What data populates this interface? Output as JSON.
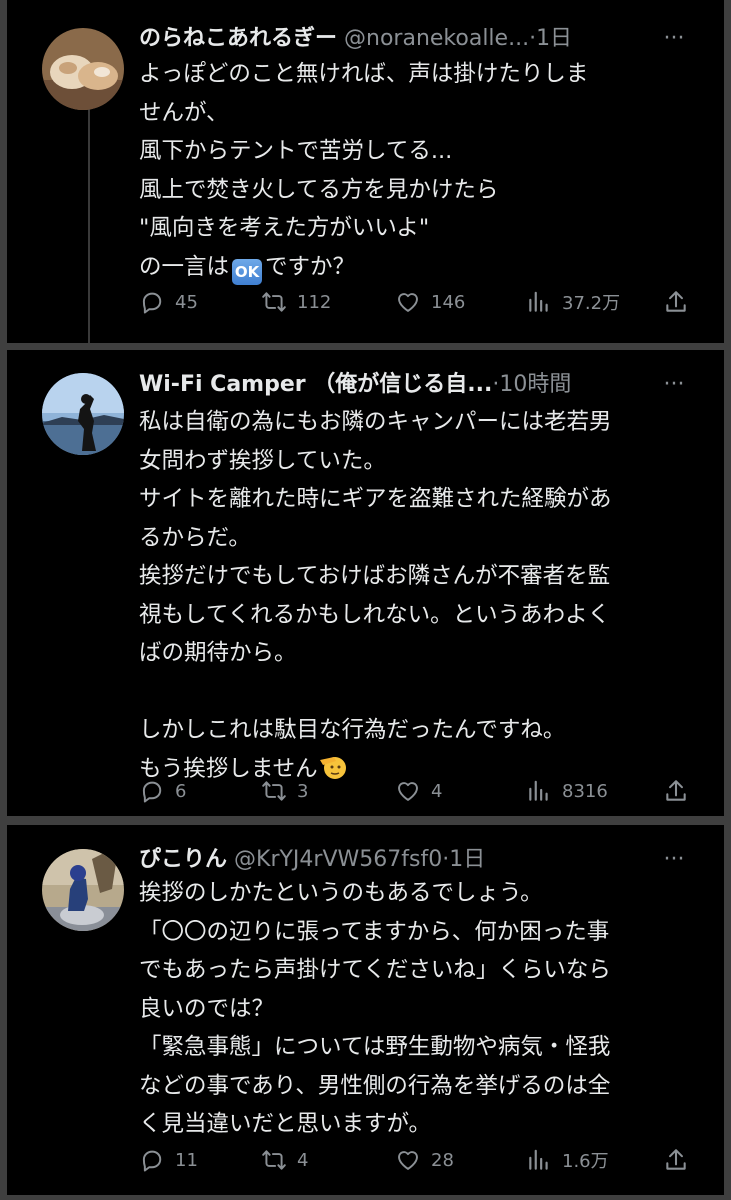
{
  "tweets": [
    {
      "name": "のらねこあれるぎー",
      "handle": "@noranekoalle...",
      "separator": "·",
      "time": "1日",
      "more": "···",
      "avatar": "cat-photo-avatar",
      "lines": [
        "よっぽどのこと無ければ、声は掛けたりしま",
        "せんが、",
        "風下からテントで苦労してる...",
        "風上で焚き火してる方を見かけたら",
        "\"風向きを考えた方がいいよ\""
      ],
      "last_line_pre": "の一言は",
      "emoji": "OK",
      "last_line_post": "ですか？",
      "replies": "45",
      "retweets": "112",
      "likes": "146",
      "views": "37.2万"
    },
    {
      "name": "Wi-Fi Camper （俺が信じる自...",
      "separator": "·",
      "time": "10時間",
      "more": "···",
      "avatar": "silhouette-lake-avatar",
      "lines": [
        "私は自衛の為にもお隣のキャンパーには老若男",
        "女問わず挨拶していた。",
        "サイトを離れた時にギアを盗難された経験があ",
        "るからだ。",
        "挨拶だけでもしておけばお隣さんが不審者を監",
        "視もしてくれるかもしれない。というあわよく",
        "ばの期待から。",
        "",
        "しかしこれは駄目な行為だったんですね。"
      ],
      "last_line": "もう挨拶しません",
      "emoji": "saluting-face-emoji",
      "replies": "6",
      "retweets": "3",
      "likes": "4",
      "views": "8316"
    },
    {
      "name": "ぴこりん",
      "handle": "@KrYJ4rVW567fsf0",
      "separator": "·",
      "time": "1日",
      "more": "···",
      "avatar": "motorcycle-rider-avatar",
      "lines": [
        "挨拶のしかたというのもあるでしょう。",
        "「〇〇の辺りに張ってますから、何か困った事",
        "でもあったら声掛けてくださいね」くらいなら",
        "良いのでは？",
        "「緊急事態」については野生動物や病気・怪我",
        "などの事であり、男性側の行為を挙げるのは全",
        "く見当違いだと思いますが。"
      ],
      "replies": "11",
      "retweets": "4",
      "likes": "28",
      "views": "1.6万"
    }
  ],
  "colors": {
    "background": "#000000",
    "frame": "#3f3f3f",
    "text": "#e7e9ea",
    "muted": "#8b9095"
  }
}
